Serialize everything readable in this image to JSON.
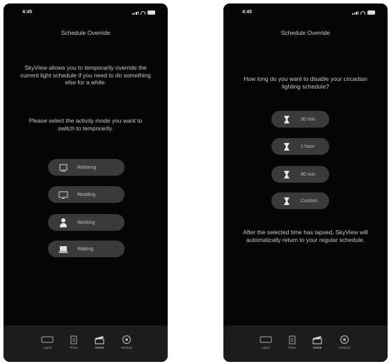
{
  "colors": {
    "phone_bg": "#050505",
    "pill_bg": "#3a3a3a",
    "tabbar_bg": "#1c1c1c",
    "text": "#c8c8c8"
  },
  "status": {
    "time": "4:45"
  },
  "screen_left": {
    "title": "Schedule Override",
    "intro": "SkyView allows you to temporarily override the current light schedule if you need to do something else for a while.",
    "prompt": "Please select the activity mode you want to switch to temporarily.",
    "modes": [
      {
        "label": "Relaxing",
        "icon": "frame-icon"
      },
      {
        "label": "Reading",
        "icon": "monitor-icon"
      },
      {
        "label": "Working",
        "icon": "person-icon"
      },
      {
        "label": "Waking",
        "icon": "laptop-icon"
      }
    ]
  },
  "screen_right": {
    "title": "Schedule Override",
    "question": "How long do you want to disable your circadian lighting schedule?",
    "durations": [
      {
        "label": "30 min",
        "icon": "timer-icon"
      },
      {
        "label": "1 hour",
        "icon": "timer-icon"
      },
      {
        "label": "90 min",
        "icon": "timer-icon"
      },
      {
        "label": "Custom",
        "icon": "timer-icon"
      }
    ],
    "footer": "After the selected time has lapsed, SkyView will automatically return to your regular schedule."
  },
  "tabbar": {
    "items": [
      {
        "label": "Lights",
        "icon": "lights-icon"
      },
      {
        "label": "Plans",
        "icon": "document-icon"
      },
      {
        "label": "Scene",
        "icon": "clapper-icon"
      },
      {
        "label": "Settings",
        "icon": "gear-icon"
      }
    ],
    "active_index": 2
  }
}
